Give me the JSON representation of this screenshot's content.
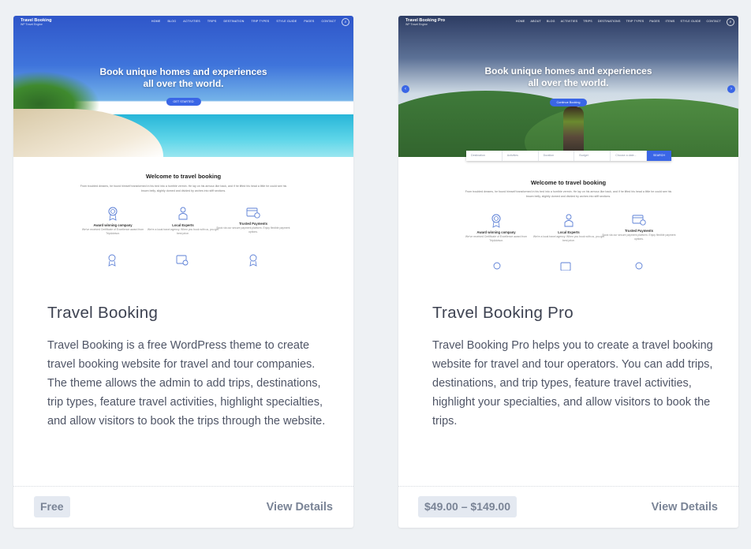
{
  "cards": [
    {
      "preview": {
        "brand": "Travel Booking",
        "brand_sub": "WP Travel Engine",
        "nav": [
          "HOME",
          "BLOG",
          "ACTIVITIES",
          "TRIPS",
          "DESTINATION",
          "TRIP TYPES",
          "STYLE GUIDE",
          "PAGES",
          "CONTACT"
        ],
        "headline_1": "Book unique homes and experiences",
        "headline_2": "all over the world.",
        "button": "GET STARTED",
        "welcome_title": "Welcome to travel booking",
        "welcome_text": "From troubled dreams, he found himself transformed in his bed into a horrible vermin. He lay on his armour-like back, and if he lifted his head a little he could see his brown belly, slightly domed and divided by arches into stiff sections.",
        "features": [
          {
            "title": "Award winning company",
            "text": "We've received Certificate of Excellence award from TripAdvisor."
          },
          {
            "title": "Local Experts",
            "text": "We're a local travel agency. When you book with us, you get best price."
          },
          {
            "title": "Trusted Payments",
            "text": "Book via our secure payment platform. Enjoy flexible payment options."
          }
        ]
      },
      "title": "Travel Booking",
      "description": "Travel Booking is a free WordPress theme to create travel booking website for travel and tour companies. The theme allows the admin to add trips, destinations, trip types, feature travel activities, highlight specialties, and allow visitors to book the trips through the website.",
      "price": "Free",
      "details_label": "View Details"
    },
    {
      "preview": {
        "brand": "Travel Booking Pro",
        "brand_sub": "WP Travel Engine",
        "nav": [
          "HOME",
          "ABOUT",
          "BLOG",
          "ACTIVITIES",
          "TRIPS",
          "DESTINATIONS",
          "TRIP TYPES",
          "PAGES",
          "ITEMS",
          "STYLE GUIDE",
          "CONTACT"
        ],
        "headline_1": "Book unique homes and experiences",
        "headline_2": "all over the world.",
        "button": "Continue Booking",
        "search": [
          "Destination",
          "Activities",
          "Duration",
          "Budget",
          "Choose a date..."
        ],
        "search_button": "SEARCH",
        "welcome_title": "Welcome to travel booking",
        "welcome_text": "From troubled dreams, he found himself transformed in his bed into a horrible vermin. He lay on his armour-like back, and if he lifted his head a little he could see his brown belly, slightly domed and divided by arches into stiff sections.",
        "features": [
          {
            "title": "Award winning company",
            "text": "We've received Certificate of Excellence award from TripAdvisor."
          },
          {
            "title": "Local Experts",
            "text": "We're a local travel agency. When you book with us, you get best price."
          },
          {
            "title": "Trusted Payments",
            "text": "Book via our secure payment platform. Enjoy flexible payment options."
          }
        ]
      },
      "title": "Travel Booking Pro",
      "description": "Travel Booking Pro helps you to create a travel booking website for travel and tour operators. You can add trips, destinations, and trip types, feature travel activities, highlight your specialties, and allow visitors to book the trips.",
      "price": "$49.00 – $149.00",
      "details_label": "View Details"
    }
  ],
  "colors": {
    "page_bg": "#eef1f4",
    "accent": "#3a66e6",
    "badge_bg": "#e4e9f1",
    "muted_text": "#7a8496"
  }
}
